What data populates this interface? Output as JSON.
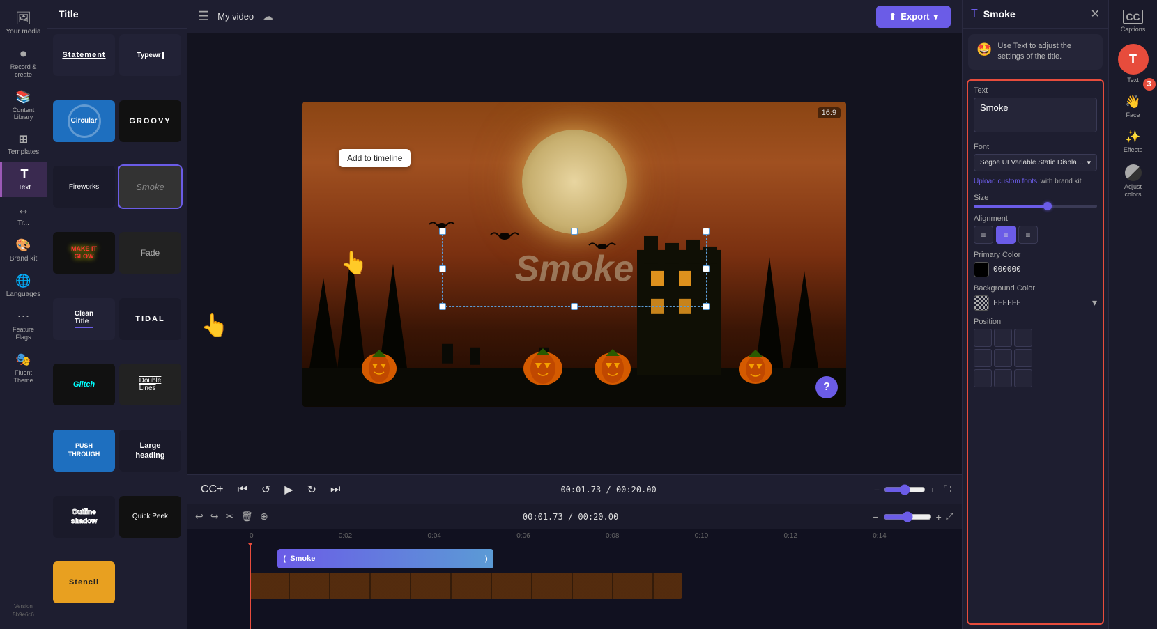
{
  "app": {
    "title": "Title",
    "project_name": "My video"
  },
  "sidebar": {
    "items": [
      {
        "id": "your-media",
        "label": "Your media",
        "icon": "🖼"
      },
      {
        "id": "record-create",
        "label": "Record &\ncreate",
        "icon": "⏺"
      },
      {
        "id": "content-library",
        "label": "Content Library",
        "icon": "📚"
      },
      {
        "id": "templates",
        "label": "Templates",
        "icon": "⊞"
      },
      {
        "id": "text",
        "label": "Text",
        "icon": "T"
      },
      {
        "id": "transitions",
        "label": "Transitions",
        "icon": "↔"
      },
      {
        "id": "brand-kit",
        "label": "Brand kit",
        "icon": "🎨"
      },
      {
        "id": "languages",
        "label": "Languages",
        "icon": "🌐"
      },
      {
        "id": "feature-flags",
        "label": "Feature Flags",
        "icon": "⋯"
      },
      {
        "id": "fluent-theme",
        "label": "Fluent Theme",
        "icon": "🎭"
      },
      {
        "id": "version",
        "label": "Version 5b9e6c6",
        "icon": ""
      }
    ]
  },
  "title_panel": {
    "header": "Title",
    "cards": [
      {
        "id": "statement",
        "label": "Statement",
        "style": "statement"
      },
      {
        "id": "typewriter",
        "label": "Typewr|",
        "style": "typewriter"
      },
      {
        "id": "circular",
        "label": "Circular",
        "style": "circular"
      },
      {
        "id": "groovy",
        "label": "GROOVY",
        "style": "groovy"
      },
      {
        "id": "fireworks",
        "label": "Fireworks",
        "style": "fireworks"
      },
      {
        "id": "smoke",
        "label": "Smoke",
        "style": "smoke"
      },
      {
        "id": "makeitglow",
        "label": "MAKE IT GLOW",
        "style": "glow"
      },
      {
        "id": "fade",
        "label": "Fade",
        "style": "fade"
      },
      {
        "id": "cleantitle",
        "label": "Clean Title",
        "style": "clean"
      },
      {
        "id": "tidal",
        "label": "TIDAL",
        "style": "tidal"
      },
      {
        "id": "glitch",
        "label": "Glitch",
        "style": "glitch"
      },
      {
        "id": "doublelines",
        "label": "Double Lines",
        "style": "doublelines"
      },
      {
        "id": "pushthrough",
        "label": "PUSH THROUGH",
        "style": "pushthrough"
      },
      {
        "id": "largeheading",
        "label": "Large heading",
        "style": "largeheading"
      },
      {
        "id": "outlineshadow",
        "label": "Outline shadow",
        "style": "outline"
      },
      {
        "id": "quickpeek",
        "label": "Quick Peek",
        "style": "quickpeek"
      },
      {
        "id": "stencil",
        "label": "Stencil",
        "style": "stencil"
      }
    ]
  },
  "video": {
    "aspect_ratio": "16:9",
    "smoke_text": "Smoke",
    "add_to_timeline": "Add to timeline"
  },
  "playback": {
    "current_time": "00:01.73",
    "total_time": "00:20.00"
  },
  "timeline": {
    "tracks": [
      {
        "id": "text-track",
        "label": "",
        "clip_label": "Smoke"
      },
      {
        "id": "video-track",
        "label": ""
      }
    ],
    "ruler_marks": [
      "0",
      "0:02",
      "0:04",
      "0:06",
      "0:08",
      "0:10",
      "0:12",
      "0:14"
    ]
  },
  "properties": {
    "title": "Smoke",
    "title_icon": "T",
    "tooltip_emoji": "🤩",
    "tooltip_text": "Use Text to adjust the settings of the title.",
    "sections": {
      "text_label": "Text",
      "text_value": "Smoke",
      "font_label": "Font",
      "font_value": "Segoe UI Variable Static Display Semibold Reg...",
      "upload_fonts": "Upload custom fonts",
      "upload_fonts_suffix": " with brand kit",
      "size_label": "Size",
      "alignment_label": "Alignment",
      "primary_color_label": "Primary Color",
      "primary_color_value": "000000",
      "bg_color_label": "Background Color",
      "bg_color_value": "FFFFFF",
      "position_label": "Position"
    }
  },
  "right_icons": {
    "items": [
      {
        "id": "captions",
        "label": "Captions",
        "icon": "CC"
      },
      {
        "id": "text",
        "label": "Text",
        "icon": "T"
      },
      {
        "id": "face",
        "label": "Face",
        "icon": "😊"
      },
      {
        "id": "effects",
        "label": "Effects",
        "icon": "✨"
      },
      {
        "id": "adjust-colors",
        "label": "Adjust colors",
        "icon": "⬤"
      }
    ]
  },
  "export": {
    "label": "Export"
  }
}
